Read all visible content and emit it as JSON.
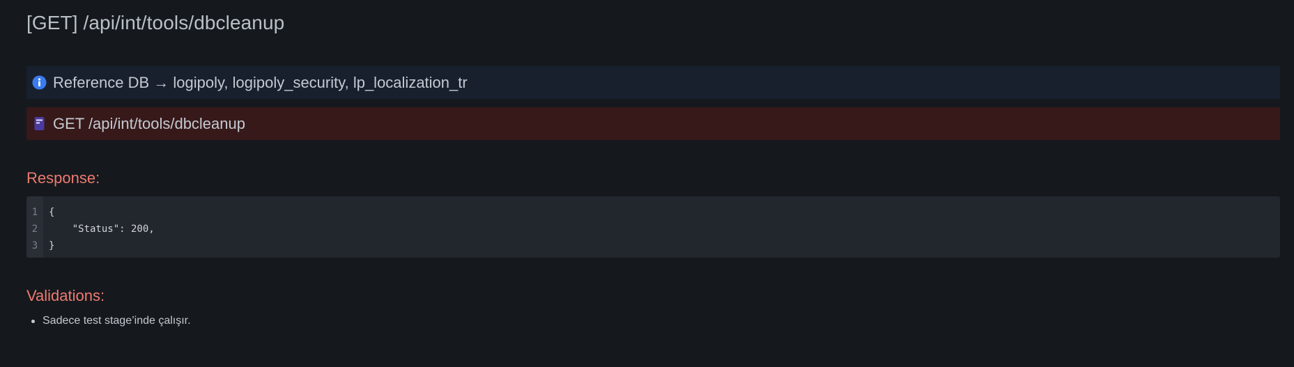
{
  "page": {
    "title": "[GET] /api/int/tools/dbcleanup"
  },
  "callouts": {
    "info": {
      "icon": "info-circle-icon",
      "text": "Reference DB → logipoly, logipoly_security, lp_localization_tr",
      "color": "#3a7bf0"
    },
    "endpoint": {
      "icon": "document-icon",
      "text": "GET /api/int/tools/dbcleanup",
      "color": "#4a3aa0"
    }
  },
  "response": {
    "heading": "Response:",
    "code": {
      "line_numbers": [
        "1",
        "2",
        "3"
      ],
      "lines": [
        "{",
        "    \"Status\": 200,",
        "}"
      ]
    }
  },
  "validations": {
    "heading": "Validations:",
    "items": [
      "Sadece test stage’inde çalışır."
    ]
  },
  "colors": {
    "background": "#15191d",
    "heading_accent": "#ee7a70",
    "info_bg": "#18202e",
    "endpoint_bg": "#37191a",
    "code_bg": "#22262d"
  }
}
